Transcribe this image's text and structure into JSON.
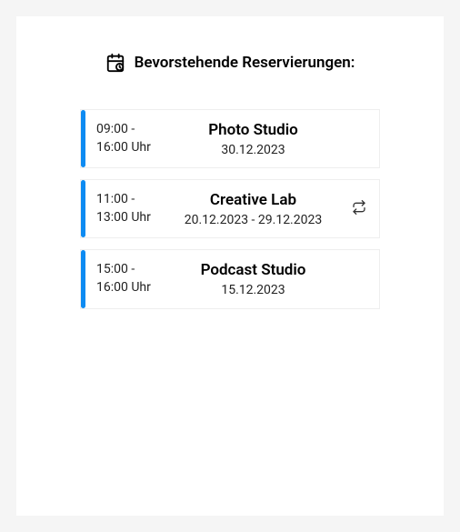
{
  "header": {
    "title": "Bevorstehende Reservierungen:"
  },
  "reservations": {
    "r0": {
      "time_start": "09:00 -",
      "time_end": "16:00 Uhr",
      "name": "Photo Studio",
      "date": "30.12.2023",
      "recurring": false
    },
    "r1": {
      "time_start": "11:00 -",
      "time_end": "13:00 Uhr",
      "name": "Creative Lab",
      "date": "20.12.2023 - 29.12.2023",
      "recurring": true
    },
    "r2": {
      "time_start": "15:00 -",
      "time_end": "16:00 Uhr",
      "name": "Podcast Studio",
      "date": "15.12.2023",
      "recurring": false
    }
  }
}
